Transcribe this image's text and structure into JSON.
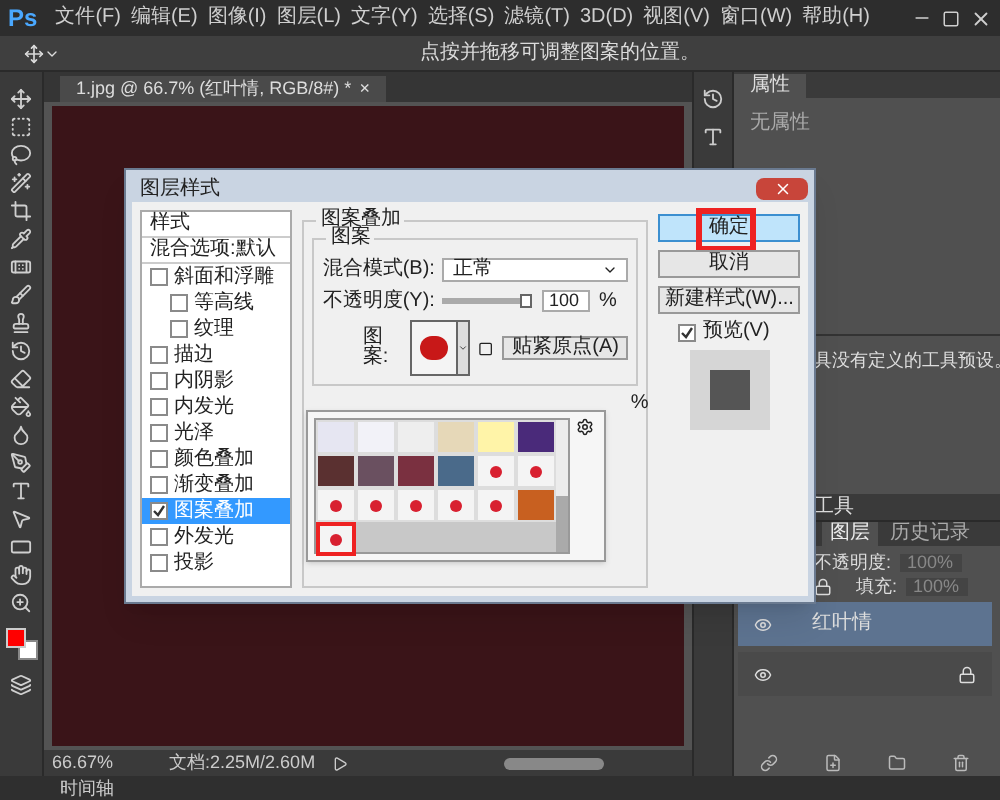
{
  "menu_bar": {
    "logo": "Ps",
    "items": [
      "文件(F)",
      "编辑(E)",
      "图像(I)",
      "图层(L)",
      "文字(Y)",
      "选择(S)",
      "滤镜(T)",
      "3D(D)",
      "视图(V)",
      "窗口(W)",
      "帮助(H)"
    ]
  },
  "options_bar": {
    "hint": "点按并拖移可调整图案的位置。"
  },
  "document": {
    "tab": "1.jpg @ 66.7% (红叶情, RGB/8#) *",
    "tab_close": "×",
    "zoom": "66.67%",
    "doc_size": "文档:2.25M/2.60M"
  },
  "properties_panel": {
    "title": "属性",
    "message": "无属性"
  },
  "tool_presets_panel": {
    "message": "具没有定义的工具预设。",
    "next_title": "工具"
  },
  "layers_panel": {
    "tabs": [
      {
        "label": "图层",
        "selected": true
      },
      {
        "label": "历史记录",
        "selected": false
      }
    ],
    "opacity_label": "不透明度:",
    "opacity": "100%",
    "fill_label": "填充:",
    "fill": "100%",
    "layers": [
      {
        "name": "红叶情",
        "selected": true,
        "locked": false
      },
      {
        "selected": false,
        "locked": true
      }
    ]
  },
  "timeline_label": "时间轴",
  "dialog": {
    "title": "图层样式",
    "styles": [
      {
        "kind": "header",
        "label": "样式",
        "selected": false
      },
      {
        "kind": "option",
        "label": "混合选项:默认",
        "selected": false
      },
      {
        "kind": "effect",
        "label": "斜面和浮雕",
        "checked": false,
        "selected": false,
        "children": [
          {
            "kind": "effect",
            "label": "等高线",
            "checked": false,
            "selected": false
          },
          {
            "kind": "effect",
            "label": "纹理",
            "checked": false,
            "selected": false
          }
        ]
      },
      {
        "kind": "effect",
        "label": "描边",
        "checked": false,
        "selected": false
      },
      {
        "kind": "effect",
        "label": "内阴影",
        "checked": false,
        "selected": false
      },
      {
        "kind": "effect",
        "label": "内发光",
        "checked": false,
        "selected": false
      },
      {
        "kind": "effect",
        "label": "光泽",
        "checked": false,
        "selected": false
      },
      {
        "kind": "effect",
        "label": "颜色叠加",
        "checked": false,
        "selected": false
      },
      {
        "kind": "effect",
        "label": "渐变叠加",
        "checked": false,
        "selected": false
      },
      {
        "kind": "effect",
        "label": "图案叠加",
        "checked": true,
        "selected": true
      },
      {
        "kind": "effect",
        "label": "外发光",
        "checked": false,
        "selected": false
      },
      {
        "kind": "effect",
        "label": "投影",
        "checked": false,
        "selected": false
      }
    ],
    "section_title": "图案叠加",
    "group_title": "图案",
    "blend_label": "混合模式(B):",
    "blend_value": "正常",
    "opacity_label": "不透明度(Y):",
    "opacity_slider": {
      "level": 1
    },
    "opacity_value": "100",
    "opacity_unit": "%",
    "pattern_label": "图案:",
    "snap_button": "贴紧原点(A)",
    "scale_unit": "%",
    "patterns": [
      {
        "selected": false
      },
      {
        "selected": false
      },
      {
        "selected": false
      },
      {
        "selected": false
      },
      {
        "selected": false
      },
      {
        "selected": false
      },
      {
        "selected": false
      },
      {
        "selected": false
      },
      {
        "selected": false
      },
      {
        "selected": false
      },
      {
        "selected": false
      },
      {
        "selected": false
      },
      {
        "selected": false
      },
      {
        "selected": false
      },
      {
        "selected": false
      },
      {
        "selected": false
      },
      {
        "selected": false
      },
      {
        "selected": false
      },
      {
        "selected": true
      }
    ],
    "buttons": [
      {
        "label": "确定",
        "default": true,
        "highlighted": true
      },
      {
        "label": "取消",
        "default": false,
        "highlighted": false
      },
      {
        "label": "新建样式(W)...",
        "default": false,
        "highlighted": false
      }
    ],
    "preview": {
      "label": "预览(V)",
      "checked": true
    }
  }
}
